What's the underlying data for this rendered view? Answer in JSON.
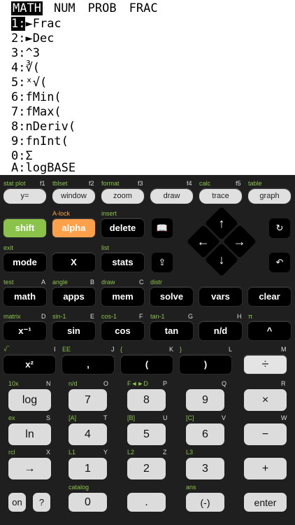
{
  "screen": {
    "tabs": [
      "MATH",
      "NUM",
      "PROB",
      "FRAC"
    ],
    "selected_tab": 0,
    "items": [
      {
        "num": "1:",
        "label": "►Frac"
      },
      {
        "num": "2:",
        "label": "►Dec"
      },
      {
        "num": "3:",
        "label": "^3"
      },
      {
        "num": "4:",
        "label": "∛("
      },
      {
        "num": "5:",
        "label": "ˣ√("
      },
      {
        "num": "6:",
        "label": "fMin("
      },
      {
        "num": "7:",
        "label": "fMax("
      },
      {
        "num": "8:",
        "label": "nDeriv("
      },
      {
        "num": "9:",
        "label": "fnInt("
      },
      {
        "num": "0:",
        "label": "Σ"
      },
      {
        "num": "A:",
        "label": "logBASE"
      }
    ]
  },
  "row0_labels": [
    "stat plot",
    "f1",
    "tblset",
    "f2",
    "format",
    "f3",
    "f4",
    "calc",
    "f5",
    "table"
  ],
  "row0_keys": [
    "y=",
    "window",
    "zoom",
    "draw",
    "trace",
    "graph"
  ],
  "row1_labels": [
    "A-lock",
    "insert"
  ],
  "row1_keys": [
    "shift",
    "alpha",
    "delete"
  ],
  "row2_labels": [
    "exit",
    "list"
  ],
  "row2_keys": [
    "mode",
    "X",
    "stats"
  ],
  "row3_labels": [
    "test",
    "A",
    "angle",
    "B",
    "draw",
    "C",
    "distr"
  ],
  "row3_keys": [
    "math",
    "apps",
    "mem",
    "solve",
    "vars",
    "clear"
  ],
  "row4_labels": [
    "matrix",
    "D",
    "sin-1",
    "E",
    "cos-1",
    "F",
    "tan-1",
    "G",
    "H",
    "π"
  ],
  "row4_keys": [
    "x⁻¹",
    "sin",
    "cos",
    "tan",
    "n/d",
    "^"
  ],
  "row5_labels": [
    "√‾",
    "I",
    "EE",
    "J",
    "{",
    "K",
    "}",
    "L",
    "M"
  ],
  "row5_keys": [
    "x²",
    ",",
    "(",
    ")",
    "÷"
  ],
  "row6_labels": [
    "10x",
    "N",
    "n/d",
    "O",
    "F◄►D",
    "P",
    "Q",
    "R"
  ],
  "row6_keys": [
    "log",
    "7",
    "8",
    "9",
    "×"
  ],
  "row7_labels": [
    "ex",
    "S",
    "[A]",
    "T",
    "[B]",
    "U",
    "[C]",
    "V",
    "W"
  ],
  "row7_keys": [
    "ln",
    "4",
    "5",
    "6",
    "−"
  ],
  "row8_labels": [
    "rcl",
    "X",
    "L1",
    "Y",
    "L2",
    "Z",
    "L3"
  ],
  "row8_keys": [
    "→",
    "1",
    "2",
    "3",
    "+"
  ],
  "row9_labels": [
    "catalog",
    "ans"
  ],
  "row9_keys": [
    "on",
    "?",
    "0",
    ".",
    "(-)",
    "enter"
  ],
  "icons": [
    "book-icon",
    "share-icon",
    "redo-icon",
    "undo-icon",
    "arrow-up-icon",
    "arrow-left-icon",
    "arrow-right-icon",
    "arrow-down-icon"
  ]
}
